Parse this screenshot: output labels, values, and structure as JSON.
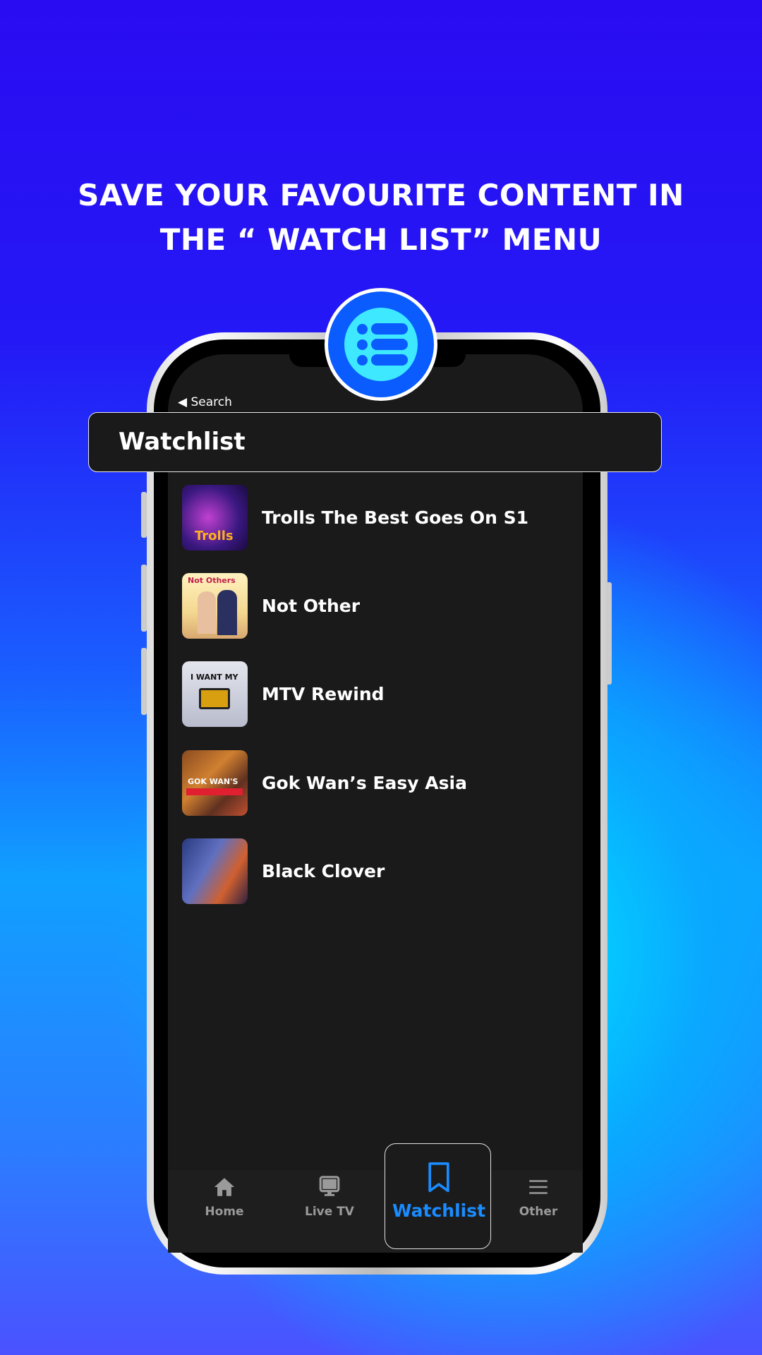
{
  "headline": {
    "line1": "SAVE YOUR FAVOURITE CONTENT IN",
    "line2": "THE “ WATCH LIST” MENU"
  },
  "badge_icon": "list-icon",
  "status_bar": {
    "back_label": "◀ Search"
  },
  "header": {
    "title": "Watchlist"
  },
  "watchlist": [
    {
      "title": "Trolls The Best Goes On S1",
      "thumb_text": "Trolls"
    },
    {
      "title": "Not Other",
      "thumb_text": "Not Others"
    },
    {
      "title": "MTV Rewind",
      "thumb_text": "I WANT MY"
    },
    {
      "title": "Gok Wan’s Easy Asia",
      "thumb_text": "GOK WAN'S"
    },
    {
      "title": "Black Clover",
      "thumb_text": ""
    }
  ],
  "bottom_nav": [
    {
      "label": "Home",
      "icon": "home-icon"
    },
    {
      "label": "Live TV",
      "icon": "tv-icon"
    },
    {
      "label": "Watchlist",
      "icon": "bookmark-icon",
      "active": true
    },
    {
      "label": "Other",
      "icon": "menu-icon"
    }
  ],
  "colors": {
    "accent": "#1a8cff",
    "badge_blue": "#0a5cff",
    "badge_cyan": "#3ee8ff",
    "screen_bg": "#1a1a1a"
  }
}
